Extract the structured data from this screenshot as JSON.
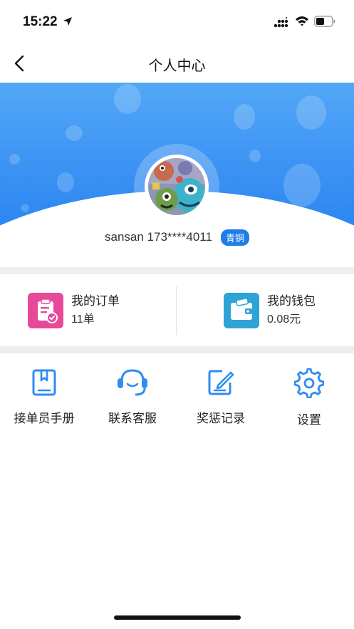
{
  "status_bar": {
    "time": "15:22"
  },
  "nav": {
    "title": "个人中心"
  },
  "profile": {
    "name_phone": "sansan 173****4011",
    "level": "青铜"
  },
  "stats": [
    {
      "title": "我的订单",
      "value": "11单",
      "icon": "order-icon",
      "color": "#e7499a"
    },
    {
      "title": "我的钱包",
      "value": "0.08元",
      "icon": "wallet-icon",
      "color": "#2fa2d6"
    }
  ],
  "tools": [
    {
      "label": "接单员手册",
      "icon": "manual-icon"
    },
    {
      "label": "联系客服",
      "icon": "headset-icon"
    },
    {
      "label": "奖惩记录",
      "icon": "edit-record-icon"
    },
    {
      "label": "设置",
      "icon": "gear-icon"
    }
  ],
  "colors": {
    "accent": "#2f8cf0",
    "badge": "#1e7de6",
    "banner": "#3d93f3"
  }
}
